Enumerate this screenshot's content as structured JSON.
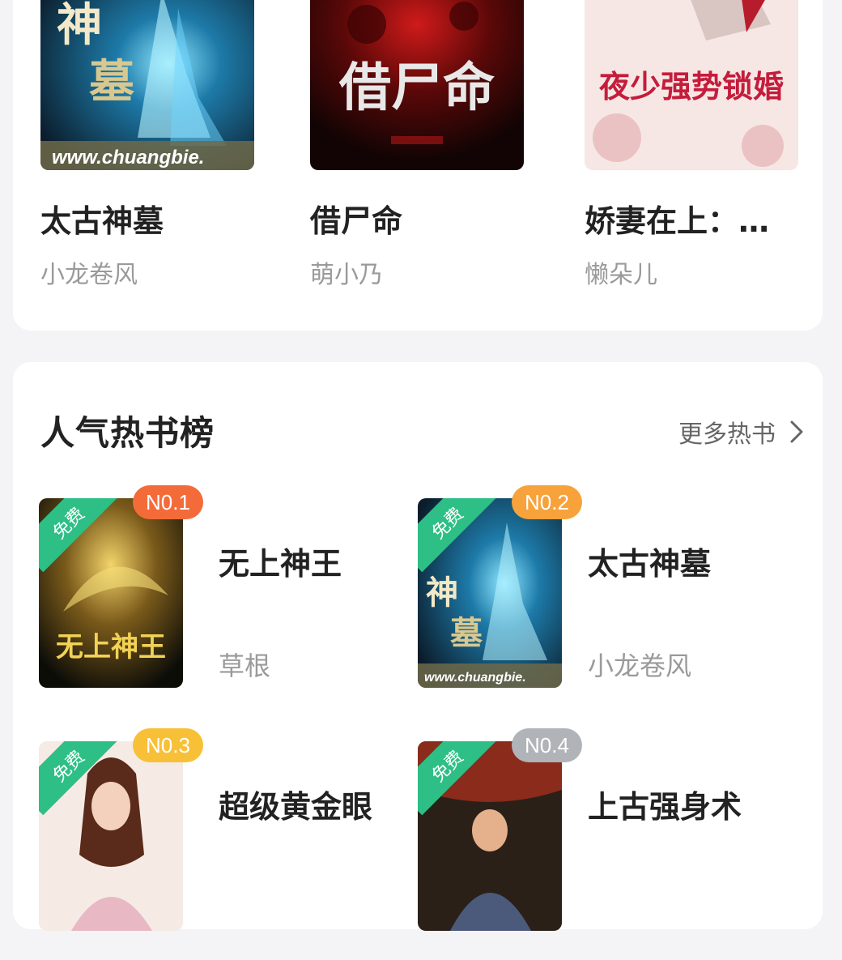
{
  "grid": [
    {
      "title": "太古神墓",
      "author": "小龙卷风",
      "cover_text": "www.chuangbie."
    },
    {
      "title": "借尸命",
      "author": "萌小乃",
      "cover_text": "借尸命"
    },
    {
      "title": "娇妻在上：…",
      "author": "懒朵儿",
      "cover_text": "夜少强势锁婚"
    }
  ],
  "rank_section": {
    "title": "人气热书榜",
    "more_label": "更多热书"
  },
  "rank_items": [
    {
      "badge": "N0.1",
      "badge_color": "#f46b3a",
      "free_label": "免费",
      "title": "无上神王",
      "author": "草根",
      "cover_text": "无上神王"
    },
    {
      "badge": "N0.2",
      "badge_color": "#f7a23a",
      "free_label": "免费",
      "title": "太古神墓",
      "author": "小龙卷风",
      "cover_text": "www.chuangbie."
    },
    {
      "badge": "N0.3",
      "badge_color": "#f8c037",
      "free_label": "免费",
      "title": "超级黄金眼",
      "author": "",
      "cover_text": ""
    },
    {
      "badge": "N0.4",
      "badge_color": "#b0b3b8",
      "free_label": "免费",
      "title": "上古强身术",
      "author": "",
      "cover_text": ""
    }
  ],
  "colors": {
    "free_ribbon": "#2dbf85",
    "background": "#f4f4f6"
  }
}
